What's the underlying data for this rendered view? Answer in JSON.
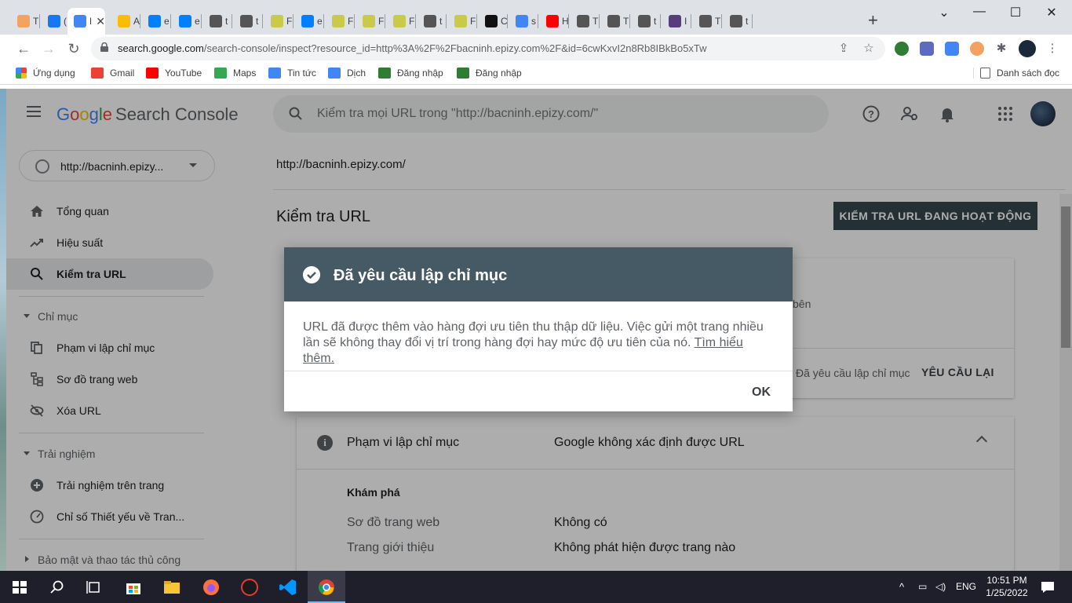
{
  "browser": {
    "tabs": [
      {
        "title": "T",
        "color": "#f4a261"
      },
      {
        "title": "(",
        "color": "#1877f2"
      },
      {
        "title": "Ki",
        "color": "#4285f4",
        "active": true
      },
      {
        "title": "A",
        "color": "#fbbc05"
      },
      {
        "title": "e",
        "color": "#0080ff"
      },
      {
        "title": "e",
        "color": "#0080ff"
      },
      {
        "title": "t",
        "color": "#555555"
      },
      {
        "title": "t",
        "color": "#555555"
      },
      {
        "title": "F",
        "color": "#c9c94a"
      },
      {
        "title": "e",
        "color": "#0080ff"
      },
      {
        "title": "F",
        "color": "#c9c94a"
      },
      {
        "title": "F",
        "color": "#c9c94a"
      },
      {
        "title": "F",
        "color": "#c9c94a"
      },
      {
        "title": "t",
        "color": "#555555"
      },
      {
        "title": "F",
        "color": "#c9c94a"
      },
      {
        "title": "C",
        "color": "#111111"
      },
      {
        "title": "s",
        "color": "#4285f4"
      },
      {
        "title": "H",
        "color": "#ff0000"
      },
      {
        "title": "T",
        "color": "#555555"
      },
      {
        "title": "T",
        "color": "#555555"
      },
      {
        "title": "t",
        "color": "#555555"
      },
      {
        "title": "I",
        "color": "#563d7c"
      },
      {
        "title": "T",
        "color": "#555555"
      },
      {
        "title": "t",
        "color": "#555555"
      }
    ],
    "url_host": "search.google.com",
    "url_path": "/search-console/inspect?resource_id=http%3A%2F%2Fbacninh.epizy.com%2F&id=6cwKxvI2n8Rb8IBkBo5xTw",
    "bookmarks": {
      "apps": "Ứng dụng",
      "gmail": "Gmail",
      "youtube": "YouTube",
      "maps": "Maps",
      "news": "Tin tức",
      "translate": "Dịch",
      "login1": "Đăng nhập",
      "login2": "Đăng nhập",
      "reading_list": "Danh sách đọc"
    }
  },
  "app": {
    "logo_google": [
      "G",
      "o",
      "o",
      "g",
      "l",
      "e"
    ],
    "logo_product": "Search Console",
    "search_placeholder": "Kiểm tra mọi URL trong \"http://bacninh.epizy.com/\"",
    "property": "http://bacninh.epizy...",
    "nav": {
      "overview": "Tổng quan",
      "performance": "Hiệu suất",
      "url_inspection": "Kiểm tra URL",
      "index_section": "Chỉ mục",
      "coverage": "Phạm vi lập chỉ mục",
      "sitemaps": "Sơ đồ trang web",
      "removals": "Xóa URL",
      "experience_section": "Trải nghiệm",
      "page_experience": "Trải nghiệm trên trang",
      "core_web_vitals": "Chỉ số Thiết yếu về Tran...",
      "security_section": "Bảo mật và thao tác thủ công"
    },
    "main": {
      "breadcrumb": "http://bacninh.epizy.com/",
      "title": "Kiểm tra URL",
      "live_test_button": "KIỂM TRA URL ĐANG HOẠT ĐỘNG",
      "card1_peek": "bên",
      "card1_requested": "Đã yêu cầu lập chỉ mục",
      "card1_request_again": "YÊU CẦU LẠI",
      "coverage_label": "Phạm vi lập chỉ mục",
      "coverage_value": "Google không xác định được URL",
      "discovery": "Khám phá",
      "sitemaps_label": "Sơ đồ trang web",
      "sitemaps_value": "Không có",
      "referring_label": "Trang giới thiệu",
      "referring_value": "Không phát hiện được trang nào"
    },
    "dialog": {
      "title": "Đã yêu cầu lập chỉ mục",
      "body": "URL đã được thêm vào hàng đợi ưu tiên thu thập dữ liệu. Việc gửi một trang nhiều lần sẽ không thay đổi vị trí trong hàng đợi hay mức độ ưu tiên của nó.",
      "link": "Tìm hiểu thêm.",
      "ok": "OK"
    }
  },
  "taskbar": {
    "lang": "ENG",
    "time": "10:51 PM",
    "date": "1/25/2022"
  },
  "colors": {
    "dialog_header": "#455a64",
    "live_button": "#37474f",
    "active_nav": "#e8eaed"
  }
}
